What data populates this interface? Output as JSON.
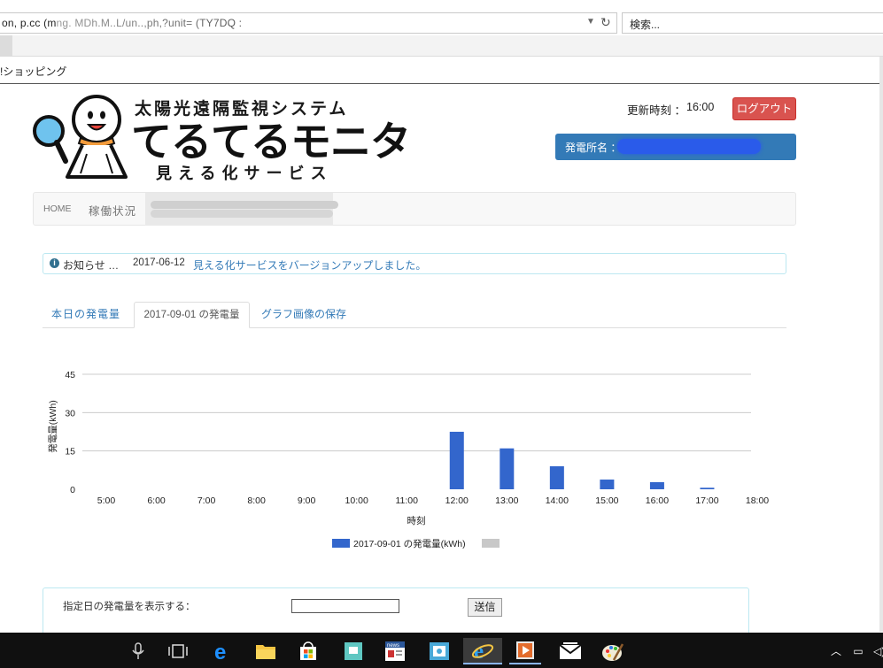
{
  "browser": {
    "address": "on, p.cc  (mng. MDh.M..L/un..,ph,?unit=  (TY7DQ   :",
    "search_placeholder": "検索...",
    "favorite": "!ショッピング"
  },
  "header": {
    "logo_top": "太陽光遠隔監視システム",
    "logo_main": "てるてるモニタ",
    "logo_sub": "見える化サービス",
    "update_label": "更新時刻 ：",
    "update_time": "16:00",
    "logout": "ログアウト",
    "station_label": "発電所名 ："
  },
  "nav": {
    "home": "HOME",
    "status": "稼働状況"
  },
  "news": {
    "label": "お知らせ …",
    "date": "2017-06-12",
    "text": "見える化サービスをバージョンアップしました。"
  },
  "tabs": [
    {
      "label": "本日の発電量"
    },
    {
      "label": "2017-09-01 の発電量"
    },
    {
      "label": "グラフ画像の保存"
    }
  ],
  "chart_data": {
    "type": "bar",
    "categories": [
      "5:00",
      "6:00",
      "7:00",
      "8:00",
      "9:00",
      "10:00",
      "11:00",
      "12:00",
      "13:00",
      "14:00",
      "15:00",
      "16:00",
      "17:00",
      "18:00"
    ],
    "series": [
      {
        "name": "2017-09-01 の発電量(kWh)",
        "values": [
          0,
          0,
          0,
          0,
          0,
          0,
          0,
          22.5,
          16,
          9,
          3.8,
          2.8,
          0.6,
          0
        ],
        "color": "#3366cc"
      },
      {
        "name": "",
        "values": [],
        "color": "#c8c8c8"
      }
    ],
    "ylim": [
      0,
      45
    ],
    "yticks": [
      0,
      15,
      30,
      45
    ],
    "xlabel": "時刻",
    "ylabel": "発電量(kWh)",
    "grid": true,
    "legend": "bottom"
  },
  "form": {
    "label": "指定日の発電量を表示する：",
    "input_value": "",
    "submit": "送信"
  },
  "taskbar": {
    "icons": [
      "microphone-icon",
      "task-view-icon",
      "edge-icon",
      "file-explorer-icon",
      "store-icon",
      "app-icon",
      "news-icon",
      "photos-icon",
      "ie-icon",
      "media-icon",
      "mail-icon",
      "paint-icon"
    ]
  }
}
